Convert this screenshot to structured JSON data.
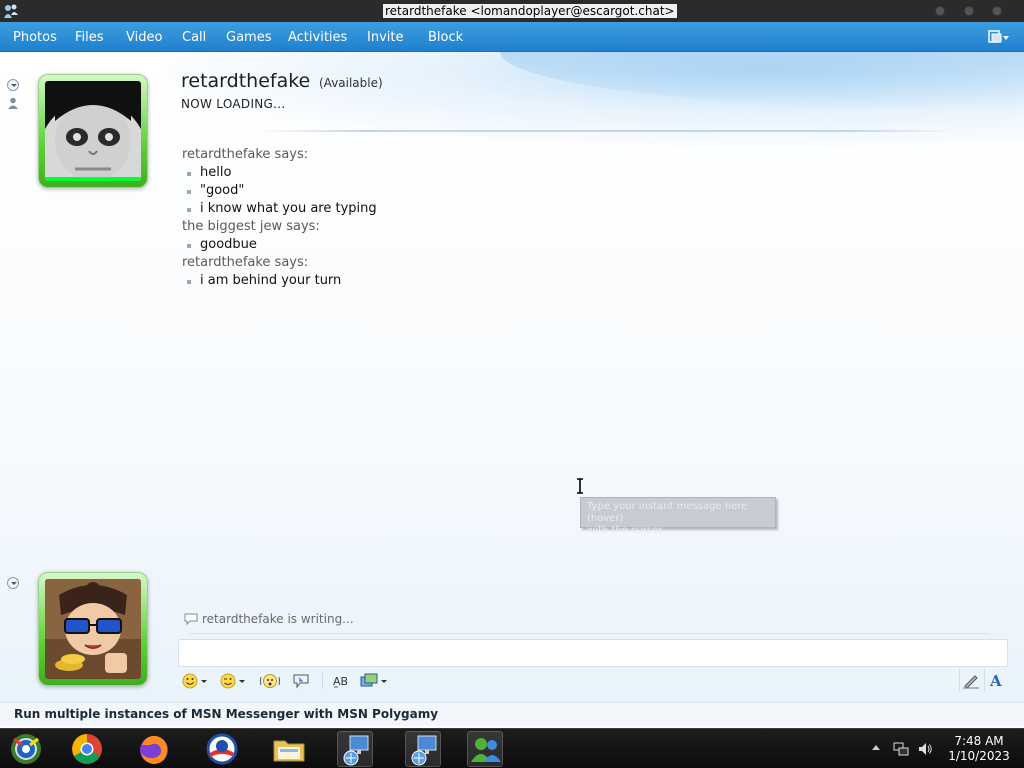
{
  "window": {
    "title": "retardthefake <lomandoplayer@escargot.chat>"
  },
  "menu": {
    "items": [
      "Photos",
      "Files",
      "Video",
      "Call",
      "Games",
      "Activities",
      "Invite",
      "Block"
    ]
  },
  "contact": {
    "name": "retardthefake",
    "status": "(Available)",
    "personal_message": "NOW LOADING..."
  },
  "conversation": [
    {
      "sender": "retardthefake says:",
      "messages": [
        "hello",
        "\"good\"",
        "i know what you are typing"
      ]
    },
    {
      "sender": "the biggest jew says:",
      "messages": [
        "goodbue"
      ]
    },
    {
      "sender": "retardthefake says:",
      "messages": [
        "i am behind your turn"
      ]
    }
  ],
  "tooltip": {
    "text": "Type your instant message here (hover)\nwith the cursor"
  },
  "typing_indicator": "retardthefake is writing...",
  "status_bar": {
    "promo": "Run multiple instances of MSN Messenger with MSN Polygamy"
  },
  "taskbar": {
    "time": "7:48 AM",
    "date": "1/10/2023",
    "apps": [
      "start-orb",
      "chrome",
      "firefox",
      "obama-logo",
      "file-explorer",
      "network-connection",
      "network-connection-2",
      "msn-messenger"
    ]
  },
  "colors": {
    "menubar": "#2a8ad6",
    "avatar_frame": "#5acb32",
    "taskbar": "#141414"
  }
}
